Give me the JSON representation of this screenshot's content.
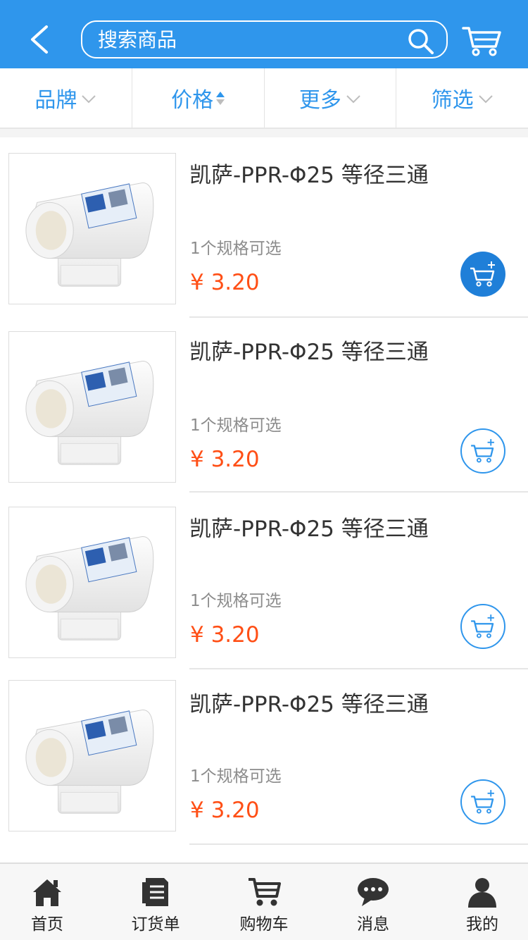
{
  "header": {
    "search_placeholder": "搜索商品",
    "bg_color": "#2f96ec"
  },
  "filters": [
    {
      "label": "品牌",
      "indicator": "chevron-down-icon"
    },
    {
      "label": "价格",
      "indicator": "sort-icon"
    },
    {
      "label": "更多",
      "indicator": "chevron-down-icon"
    },
    {
      "label": "筛选",
      "indicator": "chevron-down-icon"
    }
  ],
  "products": [
    {
      "name": "凯萨-PPR-Φ25 等径三通",
      "spec": "1个规格可选",
      "price": "¥ 3.20",
      "cart_style": "filled"
    },
    {
      "name": "凯萨-PPR-Φ25 等径三通",
      "spec": "1个规格可选",
      "price": "¥ 3.20",
      "cart_style": "outline"
    },
    {
      "name": "凯萨-PPR-Φ25 等径三通",
      "spec": "1个规格可选",
      "price": "¥ 3.20",
      "cart_style": "outline"
    },
    {
      "name": "凯萨-PPR-Φ25 等径三通",
      "spec": "1个规格可选",
      "price": "¥ 3.20",
      "cart_style": "outline"
    }
  ],
  "tabbar": [
    {
      "label": "首页",
      "icon": "home-icon"
    },
    {
      "label": "订货单",
      "icon": "order-list-icon"
    },
    {
      "label": "购物车",
      "icon": "cart-icon"
    },
    {
      "label": "消息",
      "icon": "message-icon"
    },
    {
      "label": "我的",
      "icon": "user-icon"
    }
  ],
  "colors": {
    "accent": "#2f96ec",
    "price": "#ff4f16",
    "text": "#333333",
    "muted": "#8c8c8c"
  }
}
